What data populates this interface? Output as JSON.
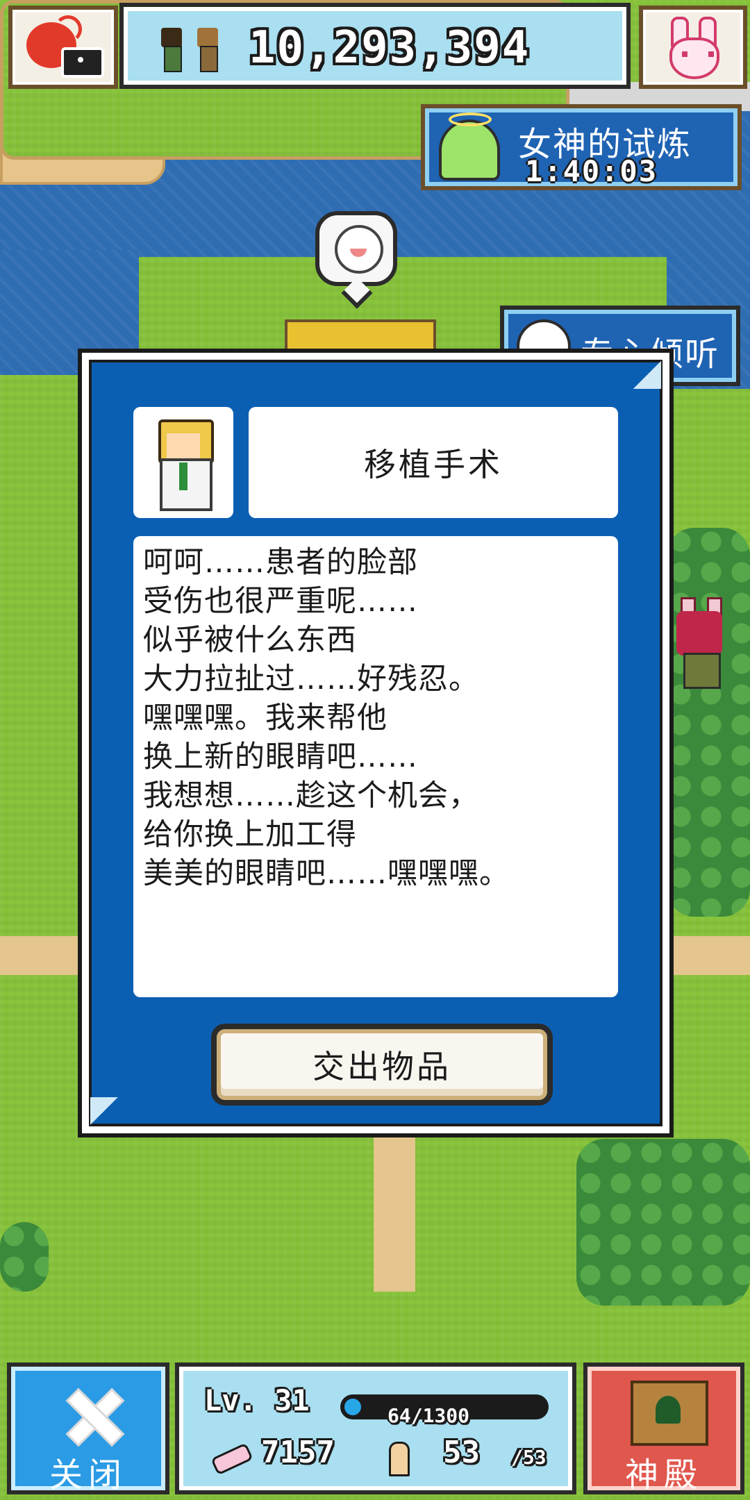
{
  "hud": {
    "gold": "10,293,394"
  },
  "quests": {
    "goddess_trial": {
      "label": "女神的试炼",
      "timer": "1:40:03"
    },
    "listen": {
      "label": "专心倾听"
    }
  },
  "dialog": {
    "title": "移植手术",
    "message_lines": [
      "呵呵……患者的脸部",
      "受伤也很严重呢……",
      "似乎被什么东西",
      "大力拉扯过……好残忍。",
      "嘿嘿嘿。我来帮他",
      "换上新的眼睛吧……",
      "我想想……趁这个机会，",
      "给你换上加工得",
      "美美的眼睛吧……嘿嘿嘿。"
    ],
    "action_label": "交出物品"
  },
  "bottom": {
    "close_label": "关闭",
    "level": "Lv. 31",
    "xp": "64/1300",
    "xp_fraction": 0.05,
    "attack": "7157",
    "stamina": "53",
    "stamina_max": "/53",
    "shrine_label": "神殿"
  },
  "colors": {
    "dialog_bg": "#0b5fb3",
    "close_button": "#2a9be4",
    "shrine_button": "#e0574d",
    "hud_panel": "#a9dff0"
  },
  "icons": {
    "camera": "camera-icon",
    "bunny": "bunny-icon",
    "close": "close-x-icon",
    "shrine": "shrine-icon",
    "attack": "claw-icon",
    "strength": "arm-icon"
  }
}
